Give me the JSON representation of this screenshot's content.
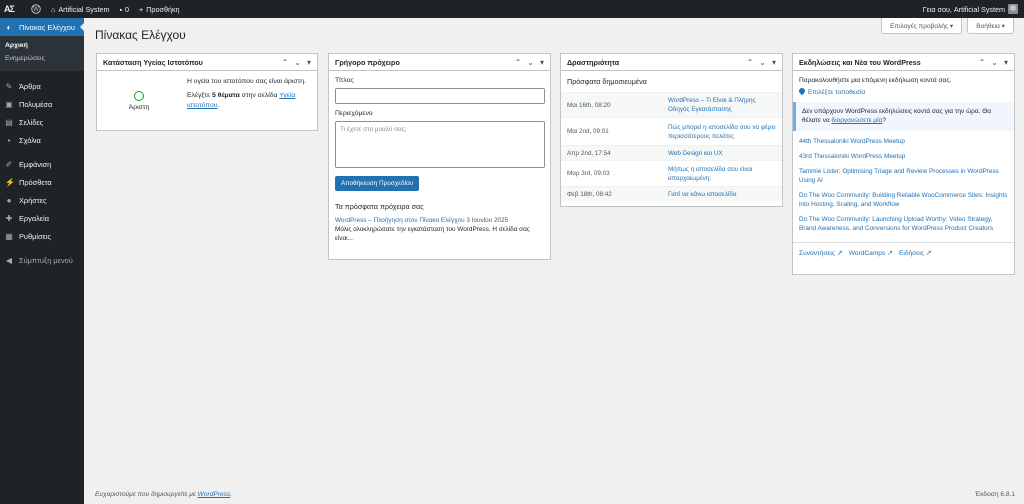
{
  "adminbar": {
    "logo": "ΑΣ",
    "site_name": "Artificial System",
    "comments_count": "0",
    "new_label": "Προσθήκη",
    "greeting": "Γεια σου, Artificial System"
  },
  "sidebar": {
    "dashboard": "Πίνακας Ελέγχου",
    "sub_home": "Αρχική",
    "sub_updates": "Ενημερώσεις",
    "items": [
      {
        "label": "Άρθρα",
        "icon": "pin-icon"
      },
      {
        "label": "Πολυμέσα",
        "icon": "media-icon"
      },
      {
        "label": "Σελίδες",
        "icon": "pages-icon"
      },
      {
        "label": "Σχόλια",
        "icon": "comments-icon"
      }
    ],
    "items2": [
      {
        "label": "Εμφάνιση",
        "icon": "brush-icon"
      },
      {
        "label": "Πρόσθετα",
        "icon": "plugin-icon"
      },
      {
        "label": "Χρήστες",
        "icon": "users-icon"
      },
      {
        "label": "Εργαλεία",
        "icon": "tools-icon"
      },
      {
        "label": "Ρυθμίσεις",
        "icon": "settings-icon"
      }
    ],
    "collapse": "Σύμπτυξη μενού"
  },
  "header": {
    "screen_options": "Επιλογές προβολής ▾",
    "help": "Βοήθεια ▾",
    "title": "Πίνακας Ελέγχου"
  },
  "health": {
    "title": "Κατάσταση Υγείας Ιστοτόπου",
    "status": "Άριστη",
    "text1": "Η υγεία του ιστοτόπου σας είναι άριστη.",
    "text2_a": "Ελέγξτε ",
    "text2_b": "5 θέματα",
    "text2_c": " στην σελίδα ",
    "text2_link": "Υγεία ιστοτόπου",
    "text2_d": "."
  },
  "quickdraft": {
    "title": "Γρήγορο πρόχειρο",
    "title_label": "Τίτλος",
    "content_label": "Περιεχόμενο",
    "placeholder": "Τι έχετε στο μυαλό σας;",
    "save": "Αποθήκευση Προσχεδίου",
    "recent": "Τα πρόσφατα πρόχειρα σας",
    "draft_link": "WordPress – Πλοήγηση στον Πίνακα Ελέγχου",
    "draft_date": " 3 Ιουνίου 2025",
    "draft_excerpt": "Μόλις ολοκληρώσατε την εγκατάσταση του WordPress. Η σελίδα σας είναι..."
  },
  "activity": {
    "title": "Δραστηριότητα",
    "subtitle": "Πρόσφατα δημοσιευμένα",
    "rows": [
      {
        "date": "Μαι 16th, 08:20",
        "link": "WordPress – Τι Είναι & Πλήρης Οδηγός Εγκατάστασης"
      },
      {
        "date": "Μαι 2nd, 09:01",
        "link": "Πώς μπορεί η ιστοσελίδα σου να φέρει περισσότερους πελάτες"
      },
      {
        "date": "Απρ 2nd, 17:54",
        "link": "Web Design και UX"
      },
      {
        "date": "Μαρ 3rd, 09:03",
        "link": "Μήπως η ιστοσελίδα σου είναι απαρχαιωμένη;"
      },
      {
        "date": "Φεβ 18th, 08:42",
        "link": "Γιατί να κάνω ιστοσελίδα"
      }
    ]
  },
  "events": {
    "title": "Εκδηλώσεις και Νέα του WordPress",
    "intro": "Παρακολουθήστε μια επόμενη εκδήλωση κοντά σας.",
    "location": "Επιλέξτε τοποθεσία",
    "notice_a": "Δεν υπάρχουν WordPress εκδηλώσεις κοντά σας για την ώρα. Θα θέλατε να ",
    "notice_link": "διοργανώσετε μία",
    "notice_b": "?",
    "news": [
      "44th Thessaloniki WordPress Meetup",
      "43rd Thessaloniki WordPress Meetup",
      "Tammie Lister: Optimising Triage and Review Processes in WordPress Using AI",
      "Do The Woo Community: Building Reliable WooCommerce Sites: Insights into Hosting, Scaling, and Workflow",
      "Do The Woo Community: Launching Upload Worthy: Video Strategy, Brand Awareness, and Conversions for WordPress Product Creators"
    ],
    "footer": [
      "Συναντήσεις",
      "WordCamps",
      "Ειδήσεις"
    ]
  },
  "footer": {
    "thanks_a": "Ευχαριστούμε που δημιουργείτε με ",
    "thanks_link": "WordPress",
    "thanks_b": ".",
    "version": "Έκδοση 6.8.1"
  },
  "colors": {
    "accent": "#2271b1",
    "adminbar": "#1d2327",
    "good": "#00a32a"
  }
}
